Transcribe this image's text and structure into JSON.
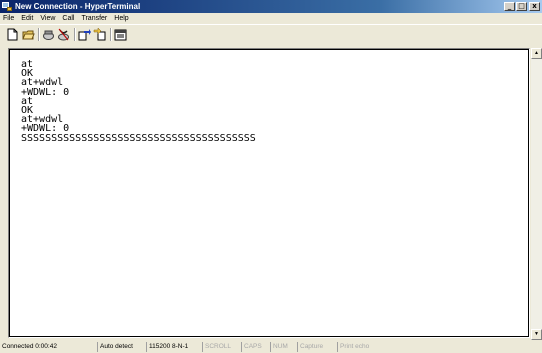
{
  "window": {
    "title": "New Connection - HyperTerminal",
    "minimize_glyph": "_",
    "maximize_glyph": "□",
    "close_glyph": "x"
  },
  "menu": [
    "File",
    "Edit",
    "View",
    "Call",
    "Transfer",
    "Help"
  ],
  "toolbar": {
    "buttons": [
      "new-connection-icon",
      "open-folder-icon",
      "phone-connect-icon",
      "phone-disconnect-icon",
      "send-file-icon",
      "receive-file-icon",
      "properties-icon"
    ]
  },
  "terminal": {
    "lines": [
      "at",
      "OK",
      "at+wdwl",
      "+WDWL: 0",
      "at",
      "OK",
      "at+wdwl",
      "+WDWL: 0",
      "SSSSSSSSSSSSSSSSSSSSSSSSSSSSSSSSSSSSSSS"
    ]
  },
  "statusbar": {
    "panels": [
      {
        "text": "Connected 0:00:42",
        "active": true
      },
      {
        "text": "Auto detect",
        "active": true
      },
      {
        "text": "115200 8-N-1",
        "active": true
      },
      {
        "text": "SCROLL",
        "active": false
      },
      {
        "text": "CAPS",
        "active": false
      },
      {
        "text": "NUM",
        "active": false
      },
      {
        "text": "Capture",
        "active": false
      },
      {
        "text": "Print echo",
        "active": false
      }
    ]
  }
}
